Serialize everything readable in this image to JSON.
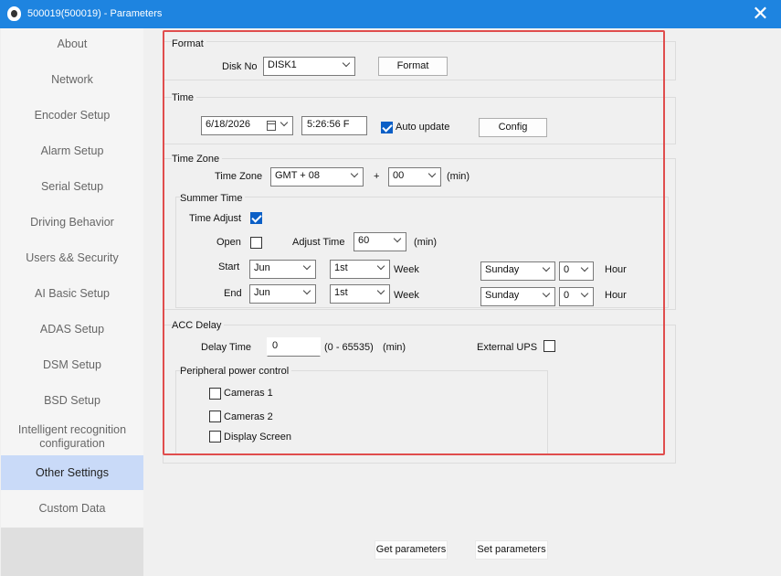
{
  "window": {
    "title": "500019(500019) - Parameters",
    "close_glyph": "✕",
    "icon": "app-logo-icon"
  },
  "sidebar": {
    "items": [
      {
        "label": "About"
      },
      {
        "label": "Network"
      },
      {
        "label": "Encoder Setup"
      },
      {
        "label": "Alarm Setup"
      },
      {
        "label": "Serial Setup"
      },
      {
        "label": "Driving Behavior"
      },
      {
        "label": "Users && Security"
      },
      {
        "label": "AI Basic Setup"
      },
      {
        "label": "ADAS Setup"
      },
      {
        "label": "DSM Setup"
      },
      {
        "label": "BSD Setup"
      },
      {
        "label": "Intelligent recognition configuration"
      },
      {
        "label": "Other Settings",
        "active": true
      },
      {
        "label": "Custom Data"
      }
    ]
  },
  "format": {
    "group_label": "Format",
    "disk_no_label": "Disk No",
    "disk_no_value": "DISK1",
    "format_button": "Format"
  },
  "time": {
    "group_label": "Time",
    "date_value": "6/18/2026",
    "time_value": "5:26:56 F",
    "auto_update_label": "Auto update",
    "auto_update_checked": true,
    "config_button": "Config"
  },
  "time_zone": {
    "group_label": "Time Zone",
    "time_zone_label": "Time Zone",
    "time_zone_value": "GMT + 08",
    "plus": "+",
    "minutes_value": "00",
    "min_unit": "(min)",
    "summer_time": {
      "group_label": "Summer Time",
      "time_adjust_label": "Time Adjust",
      "time_adjust_checked": true,
      "open_label": "Open",
      "open_checked": false,
      "adjust_time_label": "Adjust Time",
      "adjust_time_value": "60",
      "adjust_unit": "(min)",
      "start": {
        "label": "Start",
        "month": "Jun",
        "week_value": "1st",
        "week_label": "Week",
        "day": "Sunday",
        "hour": "0",
        "hour_label": "Hour"
      },
      "end": {
        "label": "End",
        "month": "Jun",
        "week_value": "1st",
        "week_label": "Week",
        "day": "Sunday",
        "hour": "0",
        "hour_label": "Hour"
      }
    }
  },
  "acc_delay": {
    "group_label": "ACC Delay",
    "delay_time_label": "Delay Time",
    "delay_time_value": "0",
    "range": "(0 - 65535)",
    "unit": "(min)",
    "external_ups_label": "External UPS",
    "external_ups_checked": false,
    "peripheral": {
      "group_label": "Peripheral power control",
      "items": [
        {
          "label": "Cameras 1",
          "checked": false
        },
        {
          "label": "Cameras 2",
          "checked": false
        },
        {
          "label": "Display Screen",
          "checked": false
        }
      ]
    }
  },
  "footer": {
    "get_button": "Get parameters",
    "set_button": "Set parameters"
  }
}
